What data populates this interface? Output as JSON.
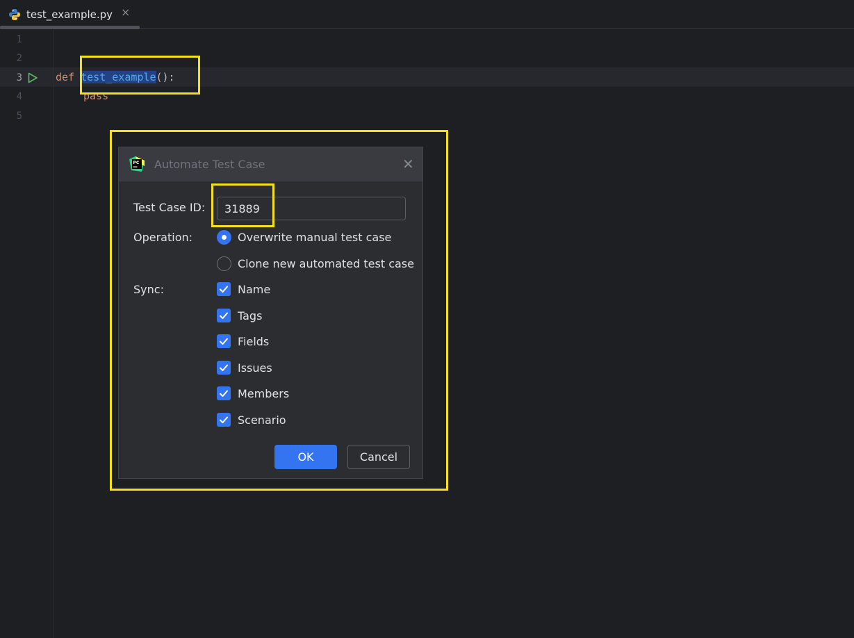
{
  "tab": {
    "filename": "test_example.py",
    "close_glyph": "×",
    "icon": "python-file-icon"
  },
  "editor": {
    "line_numbers": [
      "1",
      "2",
      "3",
      "4",
      "5"
    ],
    "active_line": 3,
    "code": {
      "line3_keyword": "def",
      "line3_function": "test_example",
      "line3_rest": "():",
      "line4_keyword": "pass"
    }
  },
  "dialog": {
    "title": "Automate Test Case",
    "close_glyph": "✕",
    "test_case_id_label": "Test Case ID:",
    "test_case_id_value": "31889",
    "operation_label": "Operation:",
    "operation_options": [
      {
        "label": "Overwrite manual test case",
        "selected": true
      },
      {
        "label": "Clone new automated test case",
        "selected": false
      }
    ],
    "sync_label": "Sync:",
    "sync_options": [
      {
        "label": "Name",
        "checked": true
      },
      {
        "label": "Tags",
        "checked": true
      },
      {
        "label": "Fields",
        "checked": true
      },
      {
        "label": "Issues",
        "checked": true
      },
      {
        "label": "Members",
        "checked": true
      },
      {
        "label": "Scenario",
        "checked": true
      }
    ],
    "ok_label": "OK",
    "cancel_label": "Cancel"
  },
  "colors": {
    "accent": "#3574f0",
    "highlight": "#f5e01a",
    "background": "#1e1f22"
  }
}
